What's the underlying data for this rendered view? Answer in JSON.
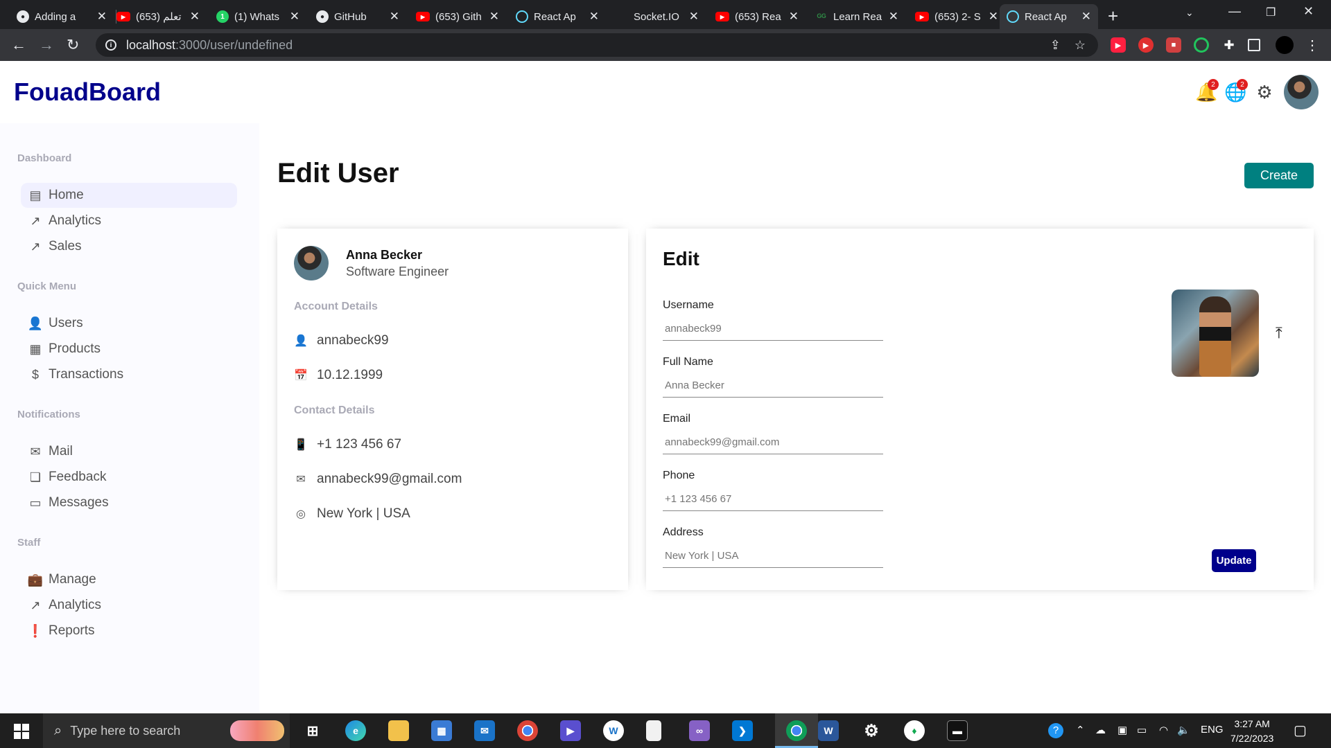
{
  "browser": {
    "tabs": [
      {
        "title": "Adding a",
        "icon": "github-icon"
      },
      {
        "title": "(653) تعلم",
        "icon": "youtube-icon"
      },
      {
        "title": "(1) Whats",
        "icon": "whatsapp-icon"
      },
      {
        "title": "GitHub",
        "icon": "github-icon"
      },
      {
        "title": "(653) Gith",
        "icon": "youtube-icon"
      },
      {
        "title": "React Ap",
        "icon": "react-icon"
      },
      {
        "title": "Socket.IO",
        "icon": "socketio-icon"
      },
      {
        "title": "(653) Rea",
        "icon": "youtube-icon"
      },
      {
        "title": "Learn Rea",
        "icon": "gfg-icon"
      },
      {
        "title": "(653) 2- S",
        "icon": "youtube-icon"
      },
      {
        "title": "React Ap",
        "icon": "react-icon",
        "active": true
      }
    ],
    "url_host": "localhost",
    "url_path": ":3000/user/undefined"
  },
  "app": {
    "logo": "FouadBoard",
    "notifications_badge": "2",
    "language_badge": "2"
  },
  "sidebar": {
    "sections": [
      {
        "title": "Dashboard",
        "items": [
          {
            "label": "Home",
            "icon": "home-icon",
            "active": true
          },
          {
            "label": "Analytics",
            "icon": "trending-up-icon"
          },
          {
            "label": "Sales",
            "icon": "trending-up-icon"
          }
        ]
      },
      {
        "title": "Quick Menu",
        "items": [
          {
            "label": "Users",
            "icon": "user-icon"
          },
          {
            "label": "Products",
            "icon": "storefront-icon"
          },
          {
            "label": "Transactions",
            "icon": "dollar-icon"
          }
        ]
      },
      {
        "title": "Notifications",
        "items": [
          {
            "label": "Mail",
            "icon": "mail-icon"
          },
          {
            "label": "Feedback",
            "icon": "feedback-icon"
          },
          {
            "label": "Messages",
            "icon": "chat-icon"
          }
        ]
      },
      {
        "title": "Staff",
        "items": [
          {
            "label": "Manage",
            "icon": "briefcase-icon"
          },
          {
            "label": "Analytics",
            "icon": "trending-up-icon"
          },
          {
            "label": "Reports",
            "icon": "report-icon"
          }
        ]
      }
    ]
  },
  "page": {
    "title": "Edit User",
    "create_label": "Create"
  },
  "user_show": {
    "name": "Anna Becker",
    "job": "Software Engineer",
    "account_title": "Account Details",
    "username": "annabeck99",
    "birthday": "10.12.1999",
    "contact_title": "Contact Details",
    "phone": "+1 123 456 67",
    "email": "annabeck99@gmail.com",
    "address": "New York | USA"
  },
  "user_edit": {
    "title": "Edit",
    "fields": {
      "username": {
        "label": "Username",
        "placeholder": "annabeck99"
      },
      "fullname": {
        "label": "Full Name",
        "placeholder": "Anna Becker"
      },
      "email": {
        "label": "Email",
        "placeholder": "annabeck99@gmail.com"
      },
      "phone": {
        "label": "Phone",
        "placeholder": "+1 123 456 67"
      },
      "address": {
        "label": "Address",
        "placeholder": "New York | USA"
      }
    },
    "update_label": "Update"
  },
  "taskbar": {
    "search_placeholder": "Type here to search",
    "language": "ENG",
    "time": "3:27 AM",
    "date": "7/22/2023"
  },
  "colors": {
    "logo": "#00008b",
    "create_button": "#008080",
    "update_button": "#00008b",
    "badge": "#e02020",
    "sidebar_bg": "#fbfbff"
  }
}
